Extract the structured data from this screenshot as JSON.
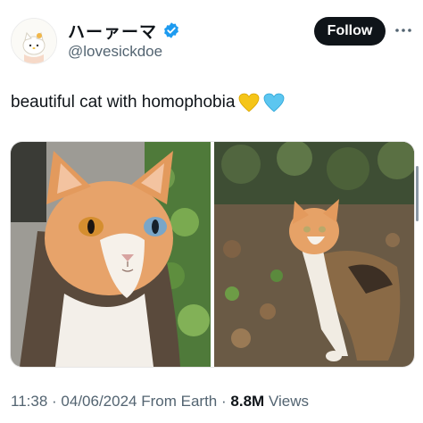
{
  "author": {
    "display_name": "ハーァーマ",
    "handle": "@lovesickdoe",
    "verified": true,
    "avatar_icon": "hello-kitty-avatar"
  },
  "actions": {
    "follow_label": "Follow",
    "more_icon": "more-dots-icon"
  },
  "tweet": {
    "text": "beautiful cat with homophobia",
    "emojis": [
      "yellow-heart",
      "light-blue-heart"
    ]
  },
  "media": {
    "images": [
      {
        "subject": "calico cat with heterochromia close-up"
      },
      {
        "subject": "calico cat standing in leaves"
      }
    ]
  },
  "meta": {
    "time": "11:38",
    "date": "04/06/2024",
    "source": "From Earth",
    "views_count": "8.8M",
    "views_label": "Views",
    "separator": "·"
  },
  "colors": {
    "verified_blue": "#1d9bf0",
    "text_primary": "#0f1419",
    "text_secondary": "#536471",
    "heart_yellow": "#f5c518",
    "heart_blue": "#5cc6f0"
  }
}
